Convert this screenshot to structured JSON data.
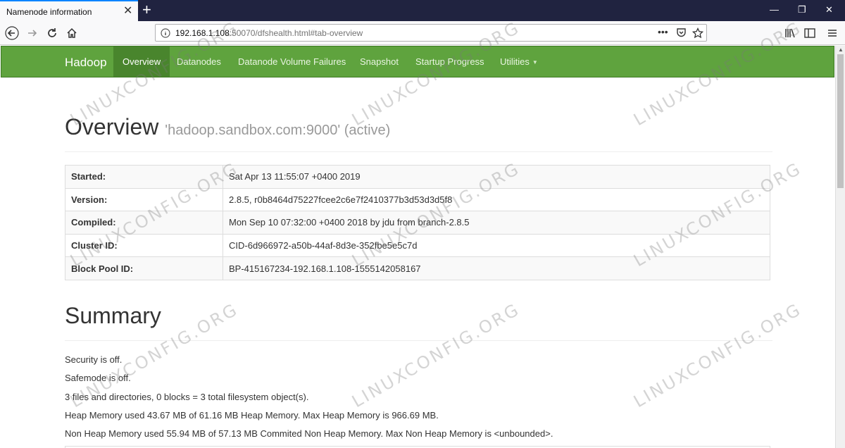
{
  "browser": {
    "tab_title": "Namenode information",
    "url_host": "192.168.1.108",
    "url_rest": ":50070/dfshealth.html#tab-overview"
  },
  "navbar": {
    "brand": "Hadoop",
    "items": [
      {
        "label": "Overview",
        "active": true
      },
      {
        "label": "Datanodes"
      },
      {
        "label": "Datanode Volume Failures"
      },
      {
        "label": "Snapshot"
      },
      {
        "label": "Startup Progress"
      },
      {
        "label": "Utilities"
      }
    ]
  },
  "overview": {
    "title": "Overview",
    "subtitle": "'hadoop.sandbox.com:9000' (active)",
    "rows": [
      {
        "key": "Started:",
        "value": "Sat Apr 13 11:55:07 +0400 2019"
      },
      {
        "key": "Version:",
        "value": "2.8.5, r0b8464d75227fcee2c6e7f2410377b3d53d3d5f8"
      },
      {
        "key": "Compiled:",
        "value": "Mon Sep 10 07:32:00 +0400 2018 by jdu from branch-2.8.5"
      },
      {
        "key": "Cluster ID:",
        "value": "CID-6d966972-a50b-44af-8d3e-352fbe5e5c7d"
      },
      {
        "key": "Block Pool ID:",
        "value": "BP-415167234-192.168.1.108-1555142058167"
      }
    ]
  },
  "summary": {
    "title": "Summary",
    "lines": [
      "Security is off.",
      "Safemode is off.",
      "3 files and directories, 0 blocks = 3 total filesystem object(s).",
      "Heap Memory used 43.67 MB of 61.16 MB Heap Memory. Max Heap Memory is 966.69 MB.",
      "Non Heap Memory used 55.94 MB of 57.13 MB Commited Non Heap Memory. Max Non Heap Memory is <unbounded>."
    ]
  },
  "watermark": "LINUXCONFIG.ORG"
}
